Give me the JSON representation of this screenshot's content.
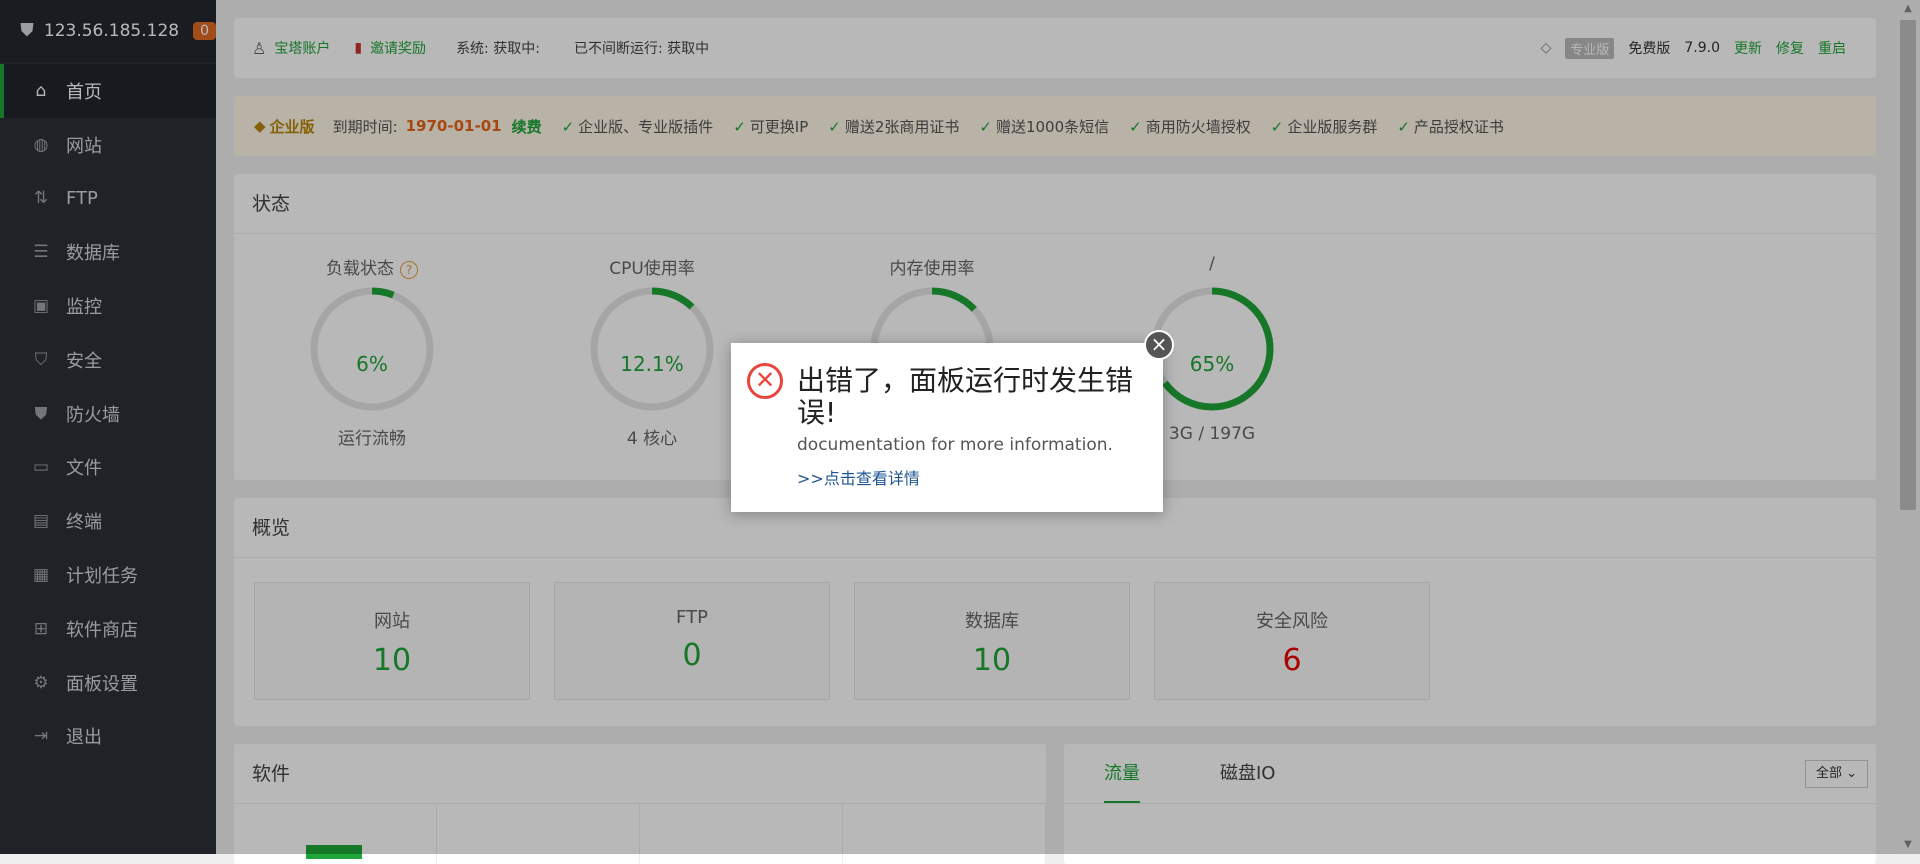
{
  "sidebar": {
    "ip": "123.56.185.128",
    "badge": "0",
    "items": [
      {
        "label": "首页",
        "icon": "home-icon"
      },
      {
        "label": "网站",
        "icon": "globe-icon"
      },
      {
        "label": "FTP",
        "icon": "ftp-icon"
      },
      {
        "label": "数据库",
        "icon": "database-icon"
      },
      {
        "label": "监控",
        "icon": "monitor-icon"
      },
      {
        "label": "安全",
        "icon": "shield-icon"
      },
      {
        "label": "防火墙",
        "icon": "firewall-icon"
      },
      {
        "label": "文件",
        "icon": "folder-icon"
      },
      {
        "label": "终端",
        "icon": "terminal-icon"
      },
      {
        "label": "计划任务",
        "icon": "calendar-icon"
      },
      {
        "label": "软件商店",
        "icon": "grid-icon"
      },
      {
        "label": "面板设置",
        "icon": "gear-icon"
      },
      {
        "label": "退出",
        "icon": "logout-icon"
      }
    ]
  },
  "topbar": {
    "account": "宝塔账户",
    "invite": "邀请奖励",
    "system": "系统:  获取中:",
    "uptime": "已不间断运行: 获取中",
    "pro_badge": "专业版",
    "free": "免费版",
    "version": "7.9.0",
    "update": "更新",
    "repair": "修复",
    "restart": "重启"
  },
  "enterprise": {
    "title": "企业版",
    "expire_label": "到期时间:",
    "expire_date": "1970-01-01",
    "renew": "续费",
    "features": [
      "企业版、专业版插件",
      "可更换IP",
      "赠送2张商用证书",
      "赠送1000条短信",
      "商用防火墙授权",
      "企业版服务群",
      "产品授权证书"
    ]
  },
  "status": {
    "title": "状态",
    "gauges": [
      {
        "title": "负载状态",
        "value": "6%",
        "sub": "运行流畅",
        "fraction": 0.06
      },
      {
        "title": "CPU使用率",
        "value": "12.1%",
        "sub": "4 核心",
        "fraction": 0.121
      },
      {
        "title": "内存使用率",
        "value": "",
        "sub": "",
        "fraction": 0.13
      },
      {
        "title": "/",
        "value": "65%",
        "sub": "3G / 197G",
        "fraction": 0.65
      }
    ]
  },
  "overview": {
    "title": "概览",
    "boxes": [
      {
        "label": "网站",
        "value": "10"
      },
      {
        "label": "FTP",
        "value": "0"
      },
      {
        "label": "数据库",
        "value": "10"
      },
      {
        "label": "安全风险",
        "value": "6"
      }
    ]
  },
  "software": {
    "title": "软件"
  },
  "traffic": {
    "tab_flow": "流量",
    "tab_disk": "磁盘IO",
    "select": "全部"
  },
  "dialog": {
    "title": "出错了，面板运行时发生错误!",
    "message": "documentation for more information.",
    "link": ">>点击查看详情"
  },
  "colors": {
    "accent": "#20a53a",
    "sidebar_bg": "#2c3138",
    "danger": "#e8463c"
  }
}
